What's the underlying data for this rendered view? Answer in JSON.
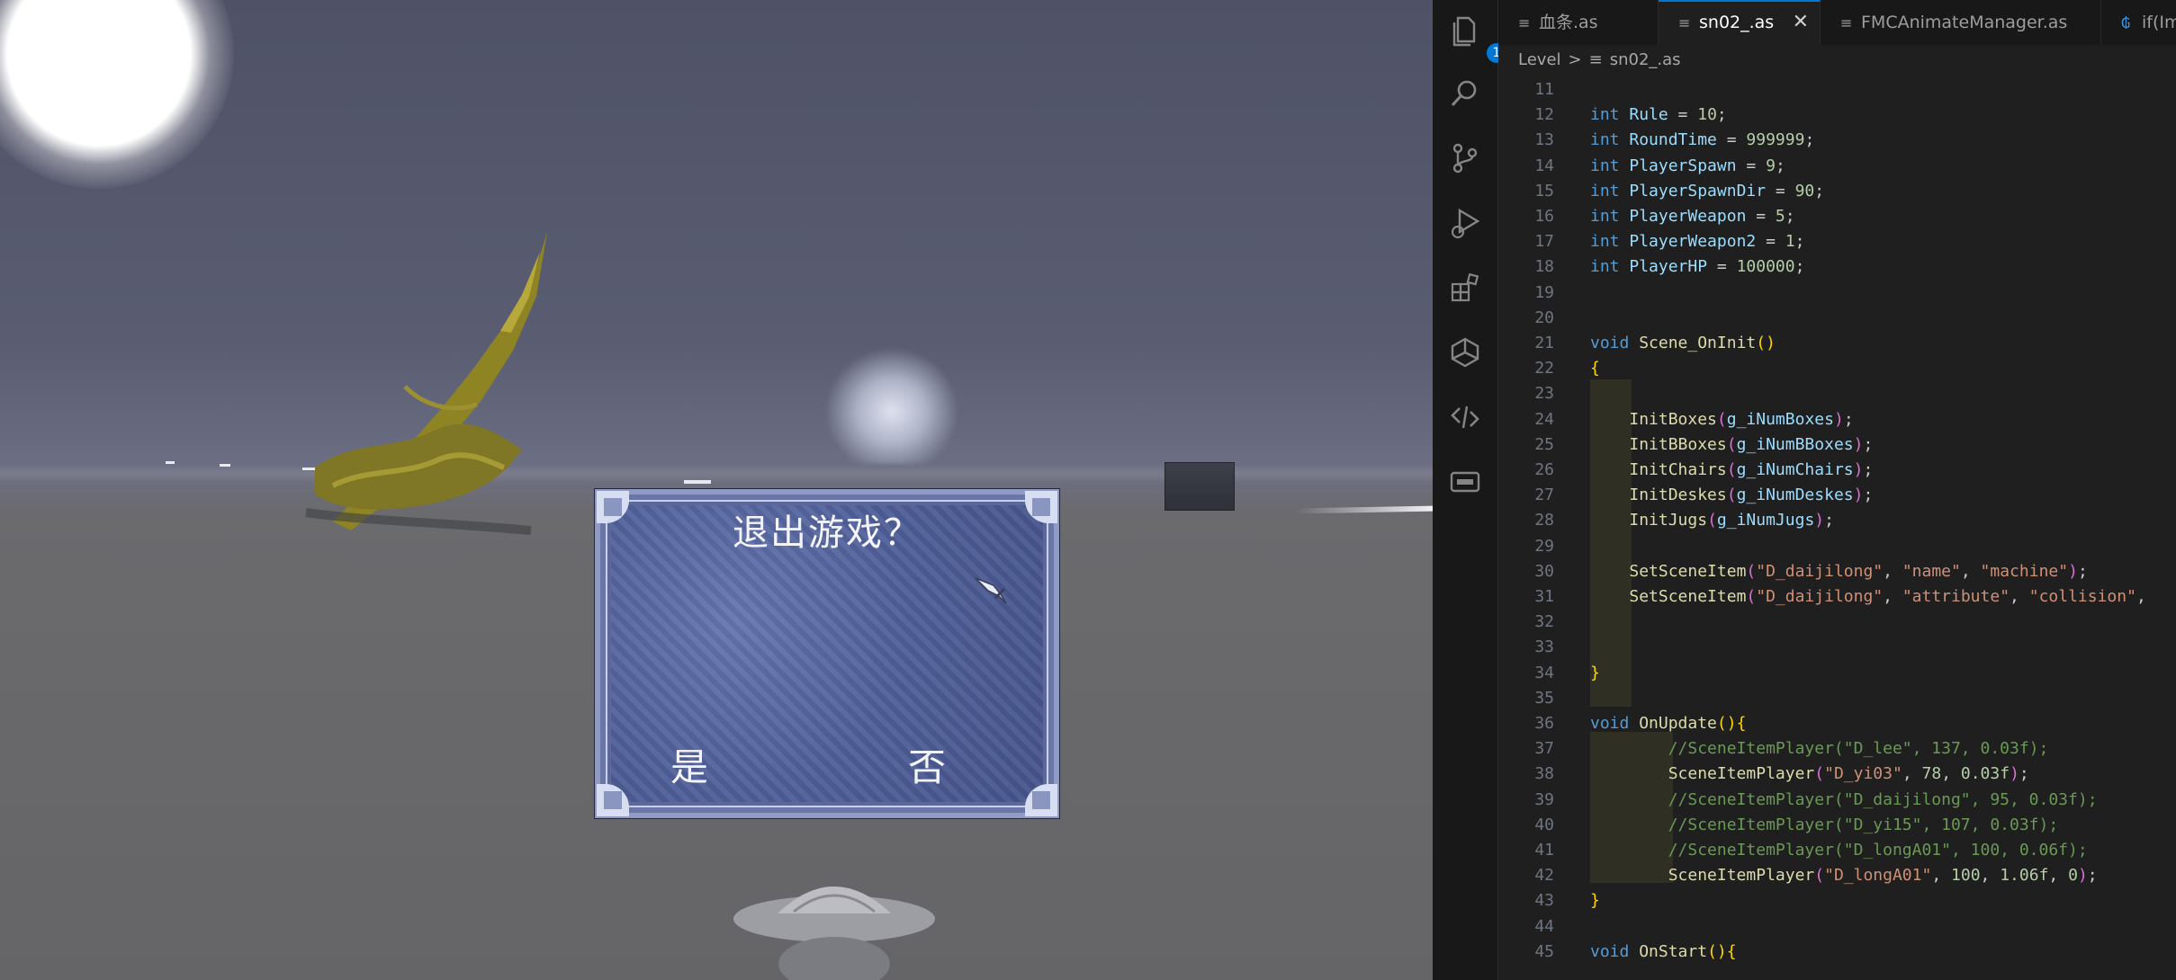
{
  "dialog": {
    "title": "退出游戏？",
    "yes_label": "是",
    "no_label": "否"
  },
  "activity_bar": {
    "explorer_badge": "1"
  },
  "tabs": [
    {
      "label": "血条.as"
    },
    {
      "label": "sn02_.as"
    },
    {
      "label": "FMCAnimateManager.as"
    },
    {
      "label": "if(ImG"
    }
  ],
  "breadcrumb": {
    "root": "Level",
    "separator": ">",
    "file": "sn02_.as"
  },
  "code_lines": [
    {
      "n": "11",
      "t": ""
    },
    {
      "n": "12",
      "t": "int Rule = 10;"
    },
    {
      "n": "13",
      "t": "int RoundTime = 999999;"
    },
    {
      "n": "14",
      "t": "int PlayerSpawn = 9;"
    },
    {
      "n": "15",
      "t": "int PlayerSpawnDir = 90;"
    },
    {
      "n": "16",
      "t": "int PlayerWeapon = 5;"
    },
    {
      "n": "17",
      "t": "int PlayerWeapon2 = 1;"
    },
    {
      "n": "18",
      "t": "int PlayerHP = 100000;"
    },
    {
      "n": "19",
      "t": ""
    },
    {
      "n": "20",
      "t": ""
    },
    {
      "n": "21",
      "t": "void Scene_OnInit()"
    },
    {
      "n": "22",
      "t": "{"
    },
    {
      "n": "23",
      "t": ""
    },
    {
      "n": "24",
      "t": "    InitBoxes(g_iNumBoxes);"
    },
    {
      "n": "25",
      "t": "    InitBBoxes(g_iNumBBoxes);"
    },
    {
      "n": "26",
      "t": "    InitChairs(g_iNumChairs);"
    },
    {
      "n": "27",
      "t": "    InitDeskes(g_iNumDeskes);"
    },
    {
      "n": "28",
      "t": "    InitJugs(g_iNumJugs);"
    },
    {
      "n": "29",
      "t": ""
    },
    {
      "n": "30",
      "t": "    SetSceneItem(\"D_daijilong\", \"name\", \"machine\");"
    },
    {
      "n": "31",
      "t": "    SetSceneItem(\"D_daijilong\", \"attribute\", \"collision\","
    },
    {
      "n": "32",
      "t": ""
    },
    {
      "n": "33",
      "t": ""
    },
    {
      "n": "34",
      "t": "}"
    },
    {
      "n": "35",
      "t": ""
    },
    {
      "n": "36",
      "t": "void OnUpdate(){"
    },
    {
      "n": "37",
      "t": "        //SceneItemPlayer(\"D_lee\", 137, 0.03f);"
    },
    {
      "n": "38",
      "t": "        SceneItemPlayer(\"D_yi03\", 78, 0.03f);"
    },
    {
      "n": "39",
      "t": "        //SceneItemPlayer(\"D_daijilong\", 95, 0.03f);"
    },
    {
      "n": "40",
      "t": "        //SceneItemPlayer(\"D_yi15\", 107, 0.03f);"
    },
    {
      "n": "41",
      "t": "        //SceneItemPlayer(\"D_longA01\", 100, 0.06f);"
    },
    {
      "n": "42",
      "t": "        SceneItemPlayer(\"D_longA01\", 100, 1.06f, 0);"
    },
    {
      "n": "43",
      "t": "}"
    },
    {
      "n": "44",
      "t": ""
    },
    {
      "n": "45",
      "t": "void OnStart(){"
    }
  ],
  "colors": {
    "accent": "#0078d4",
    "keyword": "#569cd6",
    "function": "#dcdcaa",
    "string": "#ce9178",
    "number": "#b5cea8",
    "comment": "#6a9955"
  }
}
